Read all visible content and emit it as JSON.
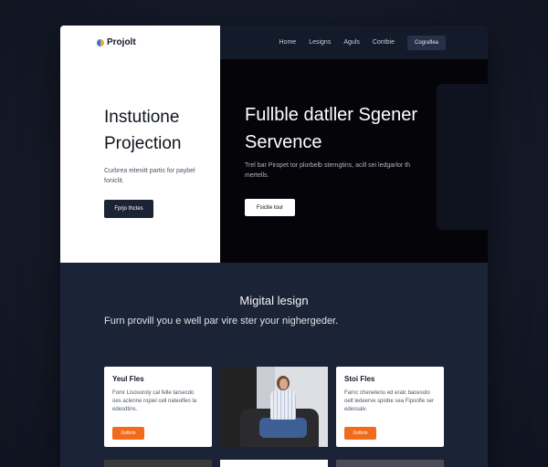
{
  "brand": {
    "name": "Projolt"
  },
  "nav": {
    "links": [
      "Home",
      "Lesigns",
      "Aguls",
      "Contbie"
    ],
    "cta": "Cograflea"
  },
  "hero_left": {
    "title": "Instutione Projection",
    "text": "Curbrea eitenitt partis for paybel foniclit.",
    "button": "Fprjo thctes"
  },
  "hero_right": {
    "title": "Fullble datller Sgener Servence",
    "text": "Trel bar Piropet tor plorbelb sterngtins, acill sei ledgarlor th mertells.",
    "button": "Fsicite tour"
  },
  "section": {
    "title": "Migital lesign",
    "subtitle": "Furn provill you e well par vire ster your nighergeder."
  },
  "cards": [
    {
      "title": "Yeul Fles",
      "text": "Fomr Lisosoroly cal felle tarsecdo oes aclenne ropiel cell nateolfen la edesdtins.",
      "button": "Golbrts"
    },
    {
      "title": "Stoi Fles",
      "text": "Farnc cheneteriu ed eralc bacesolo oelt ledeerve spiobe sea Fipoofle ser edessalv.",
      "button": "Golbrts"
    }
  ],
  "colors": {
    "accent": "#f26a1b",
    "dark": "#1c2334",
    "page_bg": "#161b29"
  }
}
